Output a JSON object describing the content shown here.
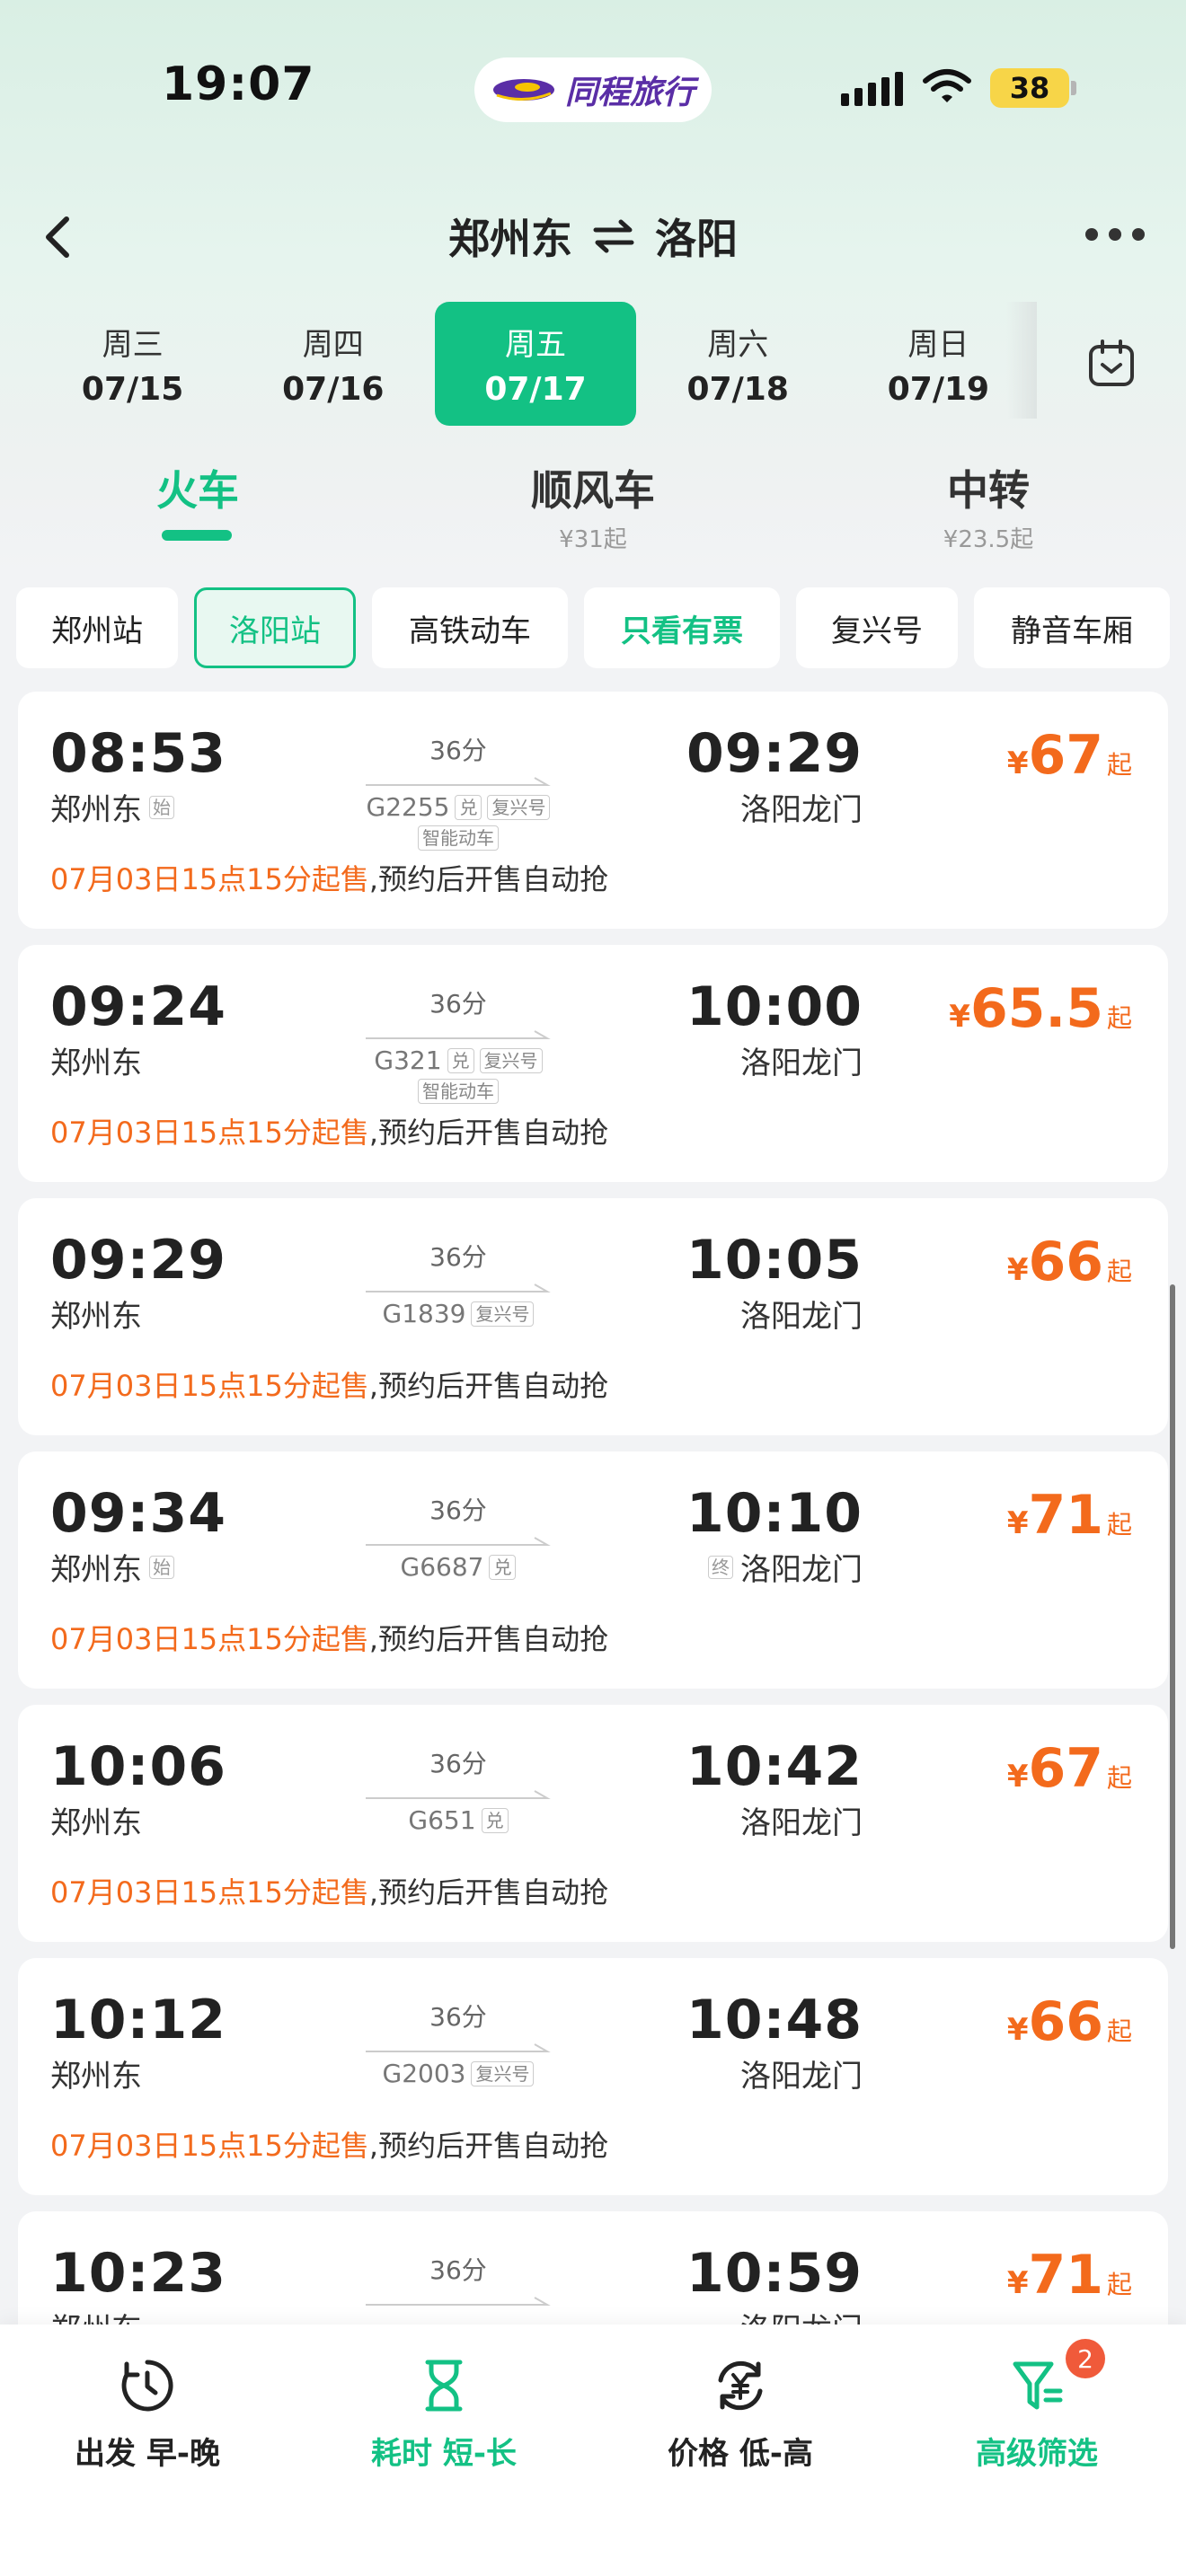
{
  "status_bar": {
    "time": "19:07",
    "battery": "38"
  },
  "brand": {
    "name": "同程旅行"
  },
  "header": {
    "from": "郑州东",
    "to": "洛阳"
  },
  "dates": [
    {
      "weekday": "周三",
      "date": "07/15"
    },
    {
      "weekday": "周四",
      "date": "07/16"
    },
    {
      "weekday": "周五",
      "date": "07/17",
      "active": true
    },
    {
      "weekday": "周六",
      "date": "07/18"
    },
    {
      "weekday": "周日",
      "date": "07/19"
    }
  ],
  "modes": [
    {
      "label": "火车",
      "sub": "",
      "active": true
    },
    {
      "label": "顺风车",
      "sub": "¥31起"
    },
    {
      "label": "中转",
      "sub": "¥23.5起"
    }
  ],
  "filters": [
    "郑州站",
    "洛阳站",
    "高铁动车",
    "只看有票",
    "复兴号",
    "静音车厢"
  ],
  "trains": [
    {
      "dep": "08:53",
      "dep_station": "郑州东",
      "dep_tag": "始",
      "duration": "36分",
      "train_no": "G2255",
      "tags": [
        "兑",
        "复兴号"
      ],
      "tag2": "智能动车",
      "arr": "09:29",
      "arr_station": "洛阳龙门",
      "arr_tag": "",
      "price": "67",
      "notice_hl": "07月03日15点15分起售",
      "notice_rest": ",预约后开售自动抢"
    },
    {
      "dep": "09:24",
      "dep_station": "郑州东",
      "dep_tag": "",
      "duration": "36分",
      "train_no": "G321",
      "tags": [
        "兑",
        "复兴号"
      ],
      "tag2": "智能动车",
      "arr": "10:00",
      "arr_station": "洛阳龙门",
      "arr_tag": "",
      "price": "65.5",
      "notice_hl": "07月03日15点15分起售",
      "notice_rest": ",预约后开售自动抢"
    },
    {
      "dep": "09:29",
      "dep_station": "郑州东",
      "dep_tag": "",
      "duration": "36分",
      "train_no": "G1839",
      "tags": [
        "复兴号"
      ],
      "tag2": "",
      "arr": "10:05",
      "arr_station": "洛阳龙门",
      "arr_tag": "",
      "price": "66",
      "notice_hl": "07月03日15点15分起售",
      "notice_rest": ",预约后开售自动抢"
    },
    {
      "dep": "09:34",
      "dep_station": "郑州东",
      "dep_tag": "始",
      "duration": "36分",
      "train_no": "G6687",
      "tags": [
        "兑"
      ],
      "tag2": "",
      "arr": "10:10",
      "arr_station": "洛阳龙门",
      "arr_tag": "终",
      "price": "71",
      "notice_hl": "07月03日15点15分起售",
      "notice_rest": ",预约后开售自动抢"
    },
    {
      "dep": "10:06",
      "dep_station": "郑州东",
      "dep_tag": "",
      "duration": "36分",
      "train_no": "G651",
      "tags": [
        "兑"
      ],
      "tag2": "",
      "arr": "10:42",
      "arr_station": "洛阳龙门",
      "arr_tag": "",
      "price": "67",
      "notice_hl": "07月03日15点15分起售",
      "notice_rest": ",预约后开售自动抢"
    },
    {
      "dep": "10:12",
      "dep_station": "郑州东",
      "dep_tag": "",
      "duration": "36分",
      "train_no": "G2003",
      "tags": [
        "复兴号"
      ],
      "tag2": "",
      "arr": "10:48",
      "arr_station": "洛阳龙门",
      "arr_tag": "",
      "price": "66",
      "notice_hl": "07月03日15点15分起售",
      "notice_rest": ",预约后开售自动抢"
    },
    {
      "dep": "10:23",
      "dep_station": "郑州东",
      "dep_tag": "",
      "duration": "36分",
      "train_no": "",
      "tags": [],
      "tag2": "",
      "arr": "10:59",
      "arr_station": "洛阳龙门",
      "arr_tag": "",
      "price": "71",
      "notice_hl": "",
      "notice_rest": ""
    }
  ],
  "price_currency": "¥",
  "price_suffix": "起",
  "bottom_bar": [
    {
      "label": "出发 早-晚",
      "icon": "clock-icon"
    },
    {
      "label": "耗时 短-长",
      "icon": "hourglass-icon",
      "active": true
    },
    {
      "label": "价格 低-高",
      "icon": "price-sort-icon"
    },
    {
      "label": "高级筛选",
      "icon": "filter-icon",
      "badge": "2"
    }
  ],
  "colors": {
    "accent": "#13c184",
    "price": "#f36a1c",
    "badge": "#f05a3a"
  }
}
